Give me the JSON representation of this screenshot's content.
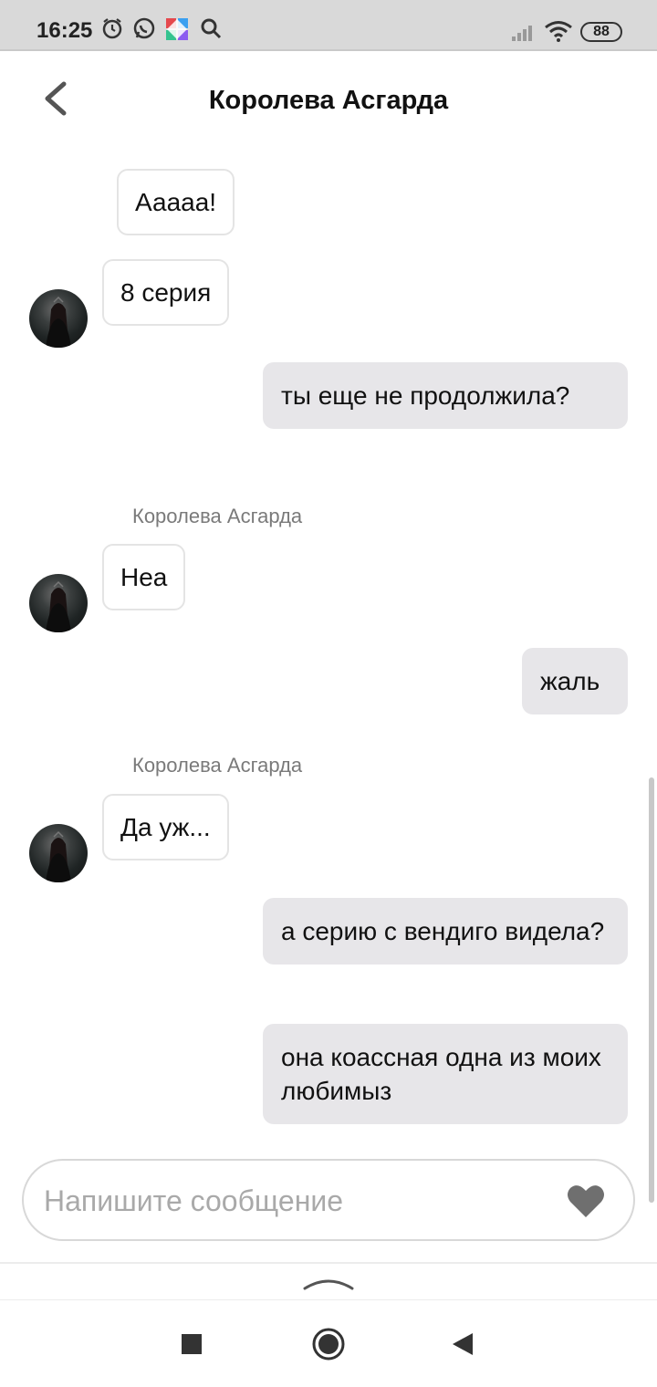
{
  "status_bar": {
    "time": "16:25",
    "battery": "88",
    "icons": [
      "alarm-icon",
      "whatsapp-icon",
      "app-icon",
      "search-icon",
      "signal-icon",
      "wifi-icon"
    ]
  },
  "header": {
    "title": "Королева Асгарда",
    "back_icon": "chevron-left-icon"
  },
  "messages": [
    {
      "direction": "in",
      "text": "Ааааа!"
    },
    {
      "direction": "in",
      "text": "8 серия"
    },
    {
      "direction": "out",
      "text": "ты еще не продолжила?"
    },
    {
      "direction": "in",
      "sender": "Королева Асгарда",
      "text": "Неа"
    },
    {
      "direction": "out",
      "text": "жаль"
    },
    {
      "direction": "in",
      "sender": "Королева Асгарда",
      "text": "Да уж..."
    },
    {
      "direction": "out",
      "text": "а серию с вендиго видела?"
    },
    {
      "direction": "out",
      "text": "она коассная одна из моих любимыз"
    }
  ],
  "composer": {
    "placeholder": "Напишите сообщение",
    "like_icon": "heart-icon"
  },
  "colors": {
    "status_bar_bg": "#d9d9d9",
    "outgoing_bubble": "#e7e6e9",
    "incoming_border": "#e4e4e4",
    "heart": "#6f6f6f"
  }
}
